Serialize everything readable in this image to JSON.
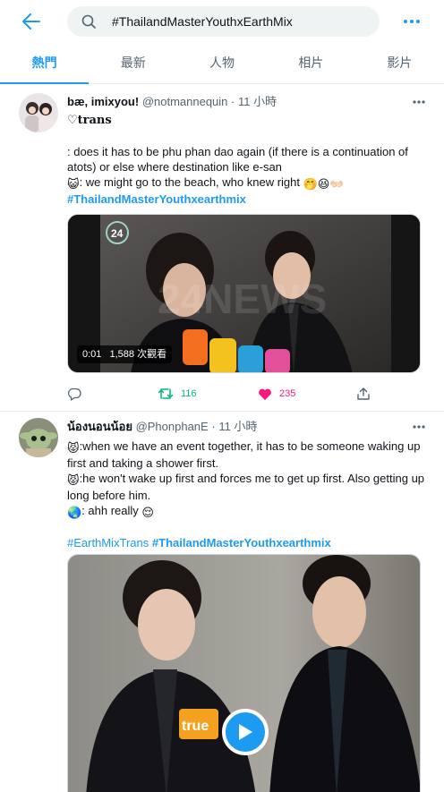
{
  "header": {
    "search_value": "#ThailandMasterYouthxEarthMix",
    "back_icon": "arrow-left-icon",
    "more_icon": "more-horizontal-icon"
  },
  "tabs": [
    {
      "label": "熱門",
      "active": true
    },
    {
      "label": "最新",
      "active": false
    },
    {
      "label": "人物",
      "active": false
    },
    {
      "label": "相片",
      "active": false
    },
    {
      "label": "影片",
      "active": false
    }
  ],
  "tweets": [
    {
      "name": "bæ, imixyou!",
      "handle": "@notmannequin",
      "dot": "·",
      "time": "11 小時",
      "line1": "♡trans",
      "line2": ": does it has to be phu phan dao again (if there is a continuation of atots) or else where destination like e-san",
      "line3_emoji": "😺",
      "line3": ": we might go to the beach, who knew right",
      "line3_trailing": "🤭😆👐🏻",
      "hashtag": "#ThailandMasterYouthxearthmix",
      "video_time": "0:01",
      "video_views": "1,588 次觀看",
      "retweets": "116",
      "likes": "235"
    },
    {
      "name": "น้องนอนน้อย",
      "handle": "@PhonphanE",
      "dot": "·",
      "time": "11 小時",
      "q1_emoji": "😾",
      "q1": ":when we have an event together, it has to be someone waking up first and taking a shower first.",
      "q2_emoji": "😾",
      "q2": ":he won't wake up first and forces me to get up first. Also getting up long before him.",
      "q3_emoji": "🌏",
      "q3": ": ahh really",
      "q3_trailing": "😌",
      "hashtag1": "#EarthMixTrans",
      "hashtag2": "#ThailandMasterYouthxearthmix"
    }
  ],
  "colors": {
    "accent": "#1d9bf0",
    "retweet": "#00ba7c",
    "like": "#f91880",
    "muted": "#536471"
  }
}
